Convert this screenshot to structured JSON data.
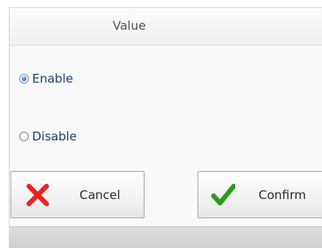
{
  "dialog": {
    "title": "Value"
  },
  "options": [
    {
      "label": "Enable",
      "checked": true
    },
    {
      "label": "Disable",
      "checked": false
    }
  ],
  "buttons": {
    "cancel_label": "Cancel",
    "cancel_icon": "x-icon",
    "confirm_label": "Confirm",
    "confirm_icon": "checkmark-icon"
  },
  "colors": {
    "cancel_icon": "#e8231f",
    "confirm_icon": "#2f9a1f",
    "radio_selected": "#2f74c0",
    "option_text": "#1e3f6e"
  }
}
